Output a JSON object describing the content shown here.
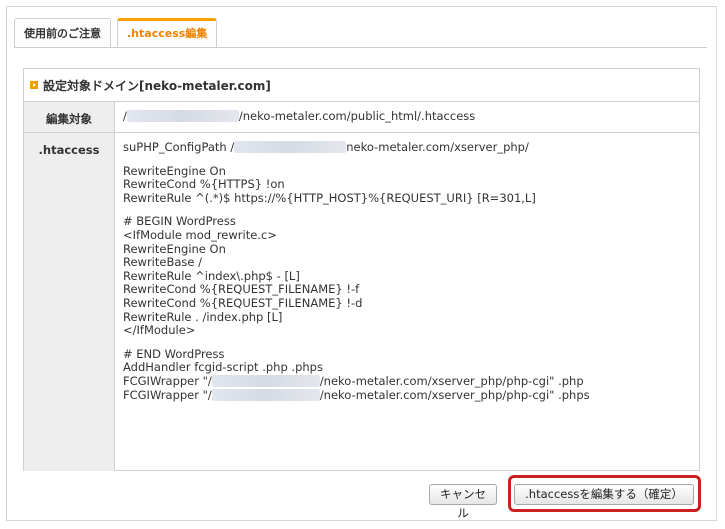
{
  "tabs": [
    {
      "label": "使用前のご注意",
      "active": false
    },
    {
      "label": ".htaccess編集",
      "active": true
    }
  ],
  "section": {
    "title": "設定対象ドメイン[neko-metaler.com]"
  },
  "rows": {
    "target_label": "編集対象",
    "target_prefix": "/",
    "target_suffix": "/neko-metaler.com/public_html/.htaccess",
    "htaccess_label": ".htaccess"
  },
  "code": {
    "line1_prefix": "suPHP_ConfigPath /",
    "line1_suffix": "neko-metaler.com/xserver_php/",
    "rewrite_engine": "RewriteEngine On",
    "rewrite_cond_https": "RewriteCond %{HTTPS} !on",
    "rewrite_rule_https": "RewriteRule ^(.*)$ https://%{HTTP_HOST}%{REQUEST_URI} [R=301,L]",
    "begin_wp": "# BEGIN WordPress",
    "ifmodule_open": "<IfModule mod_rewrite.c>",
    "rewrite_engine2": "RewriteEngine On",
    "rewrite_base": "RewriteBase /",
    "rewrite_rule_index": "RewriteRule ^index\\.php$ - [L]",
    "rewrite_cond_f": "RewriteCond %{REQUEST_FILENAME} !-f",
    "rewrite_cond_d": "RewriteCond %{REQUEST_FILENAME} !-d",
    "rewrite_rule_dot": "RewriteRule . /index.php [L]",
    "ifmodule_close": "</IfModule>",
    "end_wp": "# END WordPress",
    "addhandler": "AddHandler fcgid-script .php .phps",
    "fcgi1_prefix": "FCGIWrapper \"/",
    "fcgi1_suffix": "/neko-metaler.com/xserver_php/php-cgi\" .php",
    "fcgi2_prefix": "FCGIWrapper \"/",
    "fcgi2_suffix": "/neko-metaler.com/xserver_php/php-cgi\" .phps"
  },
  "buttons": {
    "cancel": "キャンセル",
    "confirm": ".htaccessを編集する（確定）"
  },
  "colors": {
    "accent": "#f08200",
    "highlight": "#cc1f1f",
    "header_bg": "#eeeeee"
  }
}
